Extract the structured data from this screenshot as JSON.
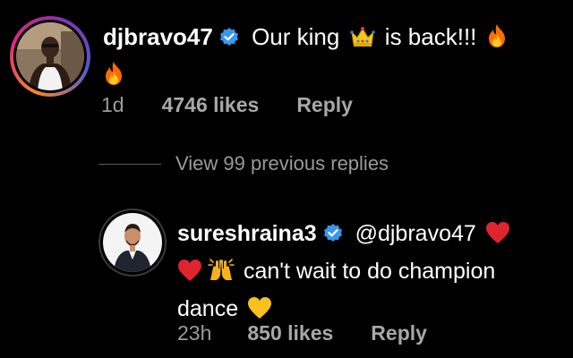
{
  "comment": {
    "username": "djbravo47",
    "text_before": "Our king",
    "text_after": "is back!!!",
    "time": "1d",
    "likes": "4746 likes",
    "reply_label": "Reply",
    "emojis": [
      "crown-emoji",
      "fire-emoji",
      "fire-emoji"
    ]
  },
  "view_replies": {
    "label": "View 99 previous replies"
  },
  "reply": {
    "username": "sureshraina3",
    "mention": "@djbravo47",
    "text_main": "can't wait to  do champion",
    "text_end": "dance",
    "time": "23h",
    "likes": "850 likes",
    "reply_label": "Reply",
    "emojis": [
      "red-heart-emoji",
      "red-heart-emoji",
      "raising-hands-emoji",
      "yellow-heart-emoji"
    ]
  },
  "colors": {
    "background": "#000000",
    "text": "#ffffff",
    "muted": "#9a9a9a",
    "verified": "#3897f0",
    "story_ring": "#dd2a7b"
  }
}
